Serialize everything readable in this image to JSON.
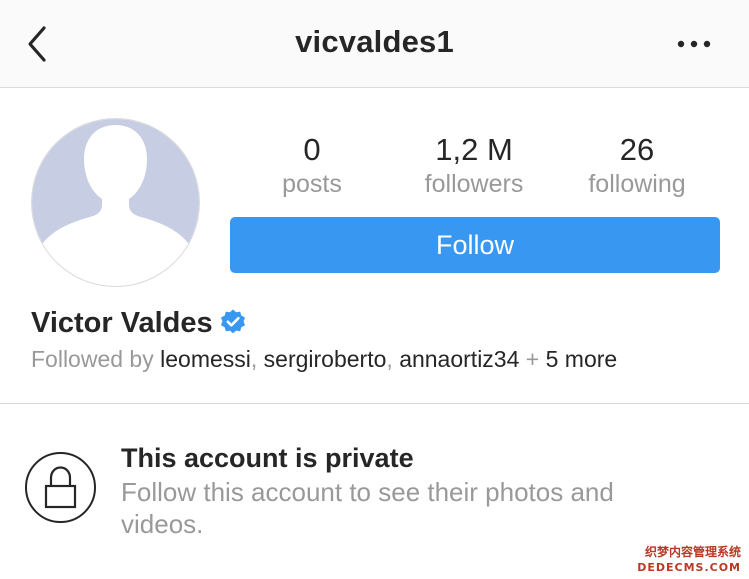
{
  "header": {
    "title": "vicvaldes1",
    "back_icon": "chevron-left-icon",
    "more_icon": "more-horizontal-icon"
  },
  "profile": {
    "avatar_icon": "default-avatar-icon",
    "stats": [
      {
        "value": "0",
        "label": "posts"
      },
      {
        "value": "1,2 M",
        "label": "followers"
      },
      {
        "value": "26",
        "label": "following"
      }
    ],
    "follow_label": "Follow",
    "full_name": "Victor Valdes",
    "verified_icon": "verified-badge-icon",
    "followed_by": {
      "prefix": "Followed by ",
      "users": [
        "leomessi",
        "sergiroberto",
        "annaortiz34"
      ],
      "separator": ", ",
      "plus": " + ",
      "more": "5 more"
    }
  },
  "private_notice": {
    "icon": "lock-icon",
    "title": "This account is private",
    "description": "Follow this account to see their photos and videos."
  },
  "watermark": {
    "line1": "织梦内容管理系统",
    "line2": "DEDECMS.COM"
  },
  "colors": {
    "accent": "#3897f0",
    "text_primary": "#262626",
    "text_secondary": "#999999",
    "divider": "#dbdbdb",
    "avatar_bg": "#c7cee3",
    "nav_bg": "#fafafa"
  }
}
